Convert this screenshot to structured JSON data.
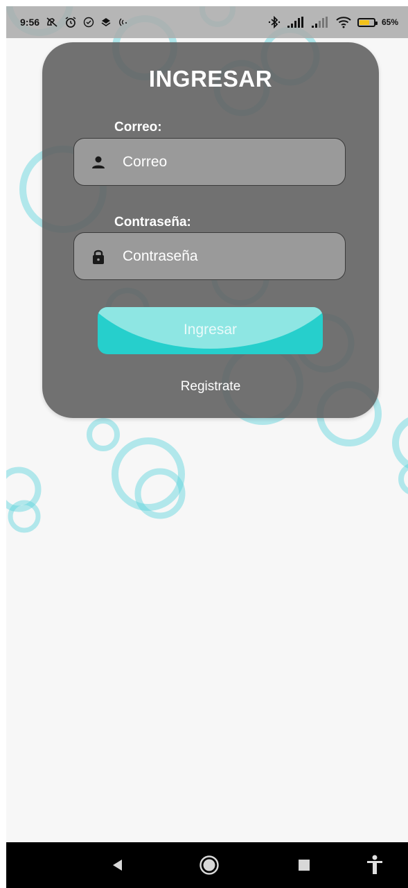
{
  "status_bar": {
    "time": "9:56",
    "battery_percent": "65%",
    "battery_level": 0.65,
    "battery_color": "#f3c21a",
    "left_icons": [
      "call-muted-icon",
      "alarm-icon",
      "check-circle-icon",
      "layers-icon",
      "nfc-icon"
    ],
    "right_icons": [
      "bluetooth-icon",
      "signal-icon",
      "signal-weak-icon",
      "wifi-icon",
      "battery-icon"
    ]
  },
  "login": {
    "title": "INGRESAR",
    "email_label": "Correo:",
    "email_placeholder": "Correo",
    "email_icon": "person-icon",
    "password_label": "Contraseña:",
    "password_placeholder": "Contraseña",
    "password_icon": "lock-icon",
    "submit_label": "Ingresar",
    "register_link": "Registrate"
  },
  "colors": {
    "accent": "#26cfcc",
    "accent_light": "#8ee6e3",
    "card": "#5f5f5f",
    "bubble": "#5bd3dc"
  },
  "nav_bar": {
    "buttons": [
      "back-icon",
      "home-icon",
      "recents-icon",
      "accessibility-icon"
    ]
  }
}
